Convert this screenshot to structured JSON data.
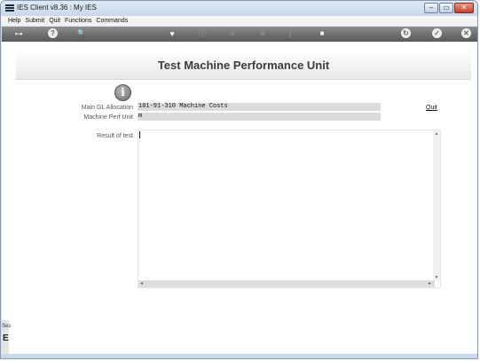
{
  "window": {
    "title": "IES Client v8.36 : My IES",
    "controls": [
      "–",
      "▭",
      "✕"
    ]
  },
  "menu": [
    "Help",
    "Submit",
    "Quit",
    "Functions",
    "Commands"
  ],
  "toolbar": {
    "key_icon": "⊶",
    "help_icon": "?",
    "search_icon": "🔍",
    "heart_icon": "♥",
    "info_icon": "ⓘ",
    "back_icon": "«",
    "forward_icon": "»",
    "rule_icon": "|",
    "stop_icon": "■",
    "refresh_icon": "↻",
    "ok_icon": "✓",
    "close_icon": "✕"
  },
  "page": {
    "title": "Test Machine Performance Unit",
    "info_glyph": "i",
    "fields": [
      {
        "label": "Main GL Allocation",
        "value": "101-91-310 Machine Costs"
      },
      {
        "label": "Machine Perf Unit",
        "value": "m"
      }
    ],
    "quit_label": "Quit",
    "result_label": "Result of test",
    "result_value": ""
  },
  "side_panel": {
    "label": "Ses",
    "glyph": "E"
  }
}
